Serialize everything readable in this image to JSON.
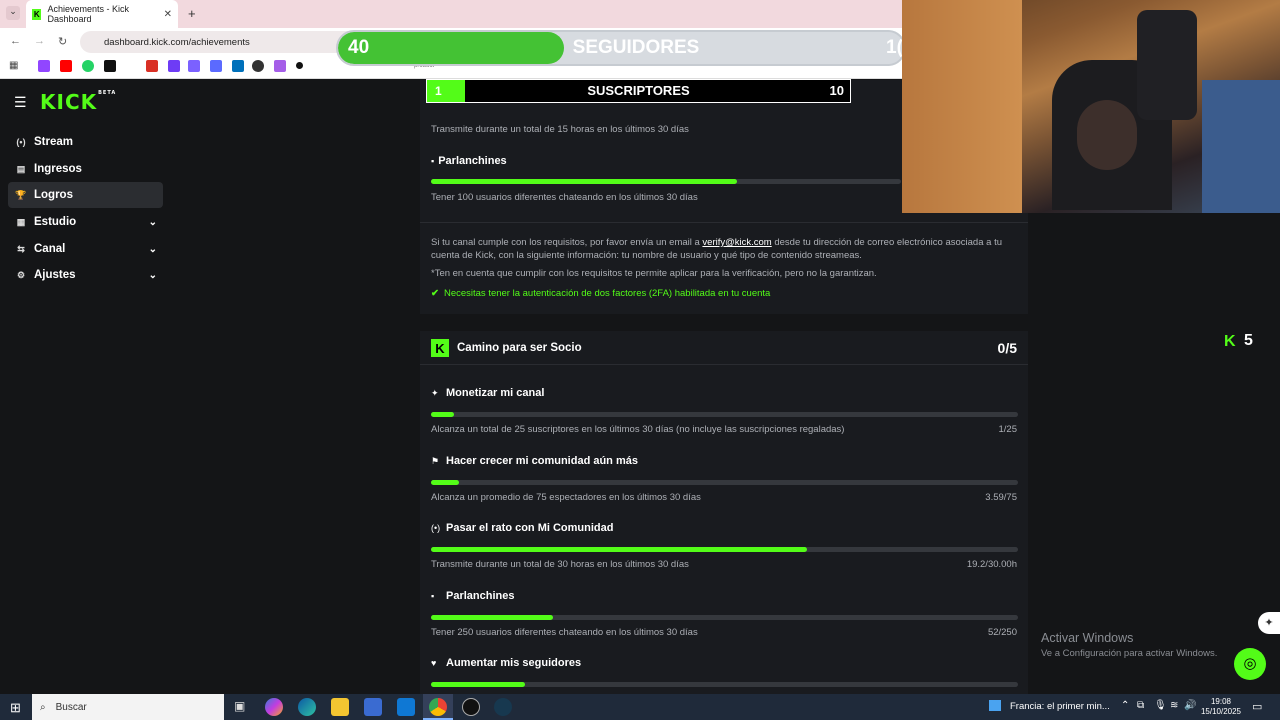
{
  "browser": {
    "tab_title": "Achievements - Kick Dashboard",
    "tab_favicon": "K",
    "tab_close": "✕",
    "new_tab": "+",
    "url": "dashboard.kick.com/achievements",
    "bookmark_fragment": "product"
  },
  "sidebar": {
    "logo": "KICK",
    "logo_badge": "BETA",
    "items": [
      {
        "label": "Stream",
        "icon": "(•)"
      },
      {
        "label": "Ingresos",
        "icon": "▤"
      },
      {
        "label": "Logros",
        "icon": "🏆"
      },
      {
        "label": "Estudio",
        "icon": "▦"
      },
      {
        "label": "Canal",
        "icon": "⇆"
      },
      {
        "label": "Ajustes",
        "icon": "⚙"
      }
    ]
  },
  "overlay_followers": {
    "current": "40",
    "label": "SEGUIDORES",
    "target": "1("
  },
  "overlay_subs": {
    "current": "1",
    "label": "SUSCRIPTORES",
    "target": "10"
  },
  "verification": {
    "hours_text": "Transmite durante un total de 15 horas en los últimos 30 días",
    "chatters_title": "Parlanchines",
    "chatters_text": "Tener 100 usuarios diferentes chateando en los últimos 30 días",
    "chatters_progress": 0.65,
    "info_line1": "Si tu canal cumple con los requisitos, por favor envía un email a",
    "info_email": "verify@kick.com",
    "info_line1b": "desde tu dirección de correo electrónico asociada",
    "info_line2": "a tu cuenta de Kick, con la siguiente información: tu nombre de usuario y qué tipo de contenido streameas.",
    "info_note": "*Ten en cuenta que cumplir con los requisitos te permite aplicar para la verificación, pero no la garantizan.",
    "twofa": "Necesitas tener la autenticación de dos factores (2FA) habilitada en tu cuenta"
  },
  "partner": {
    "title": "Camino para ser Socio",
    "count": "0/5",
    "items": [
      {
        "icon": "✦",
        "title": "Monetizar mi canal",
        "desc": "Alcanza un total de 25 suscriptores en los últimos 30 días (no incluye las suscripciones regaladas)",
        "value": "1/25",
        "progress": 0.04
      },
      {
        "icon": "⚑",
        "title": "Hacer crecer mi comunidad aún más",
        "desc": "Alcanza un promedio de 75 espectadores en los últimos 30 días",
        "value": "3.59/75",
        "progress": 0.048
      },
      {
        "icon": "(•)",
        "title": "Pasar el rato con Mi Comunidad",
        "desc": "Transmite durante un total de 30 horas en los últimos 30 días",
        "value": "19.2/30.00h",
        "progress": 0.64
      },
      {
        "icon": "▪",
        "title": "Parlanchines",
        "desc": "Tener 250 usuarios diferentes chateando en los últimos 30 días",
        "value": "52/250",
        "progress": 0.208
      },
      {
        "icon": "♥",
        "title": "Aumentar mis seguidores",
        "desc": "",
        "value": "",
        "progress": 0.16
      }
    ]
  },
  "side_badge": "5",
  "windows_watermark": {
    "title": "Activar Windows",
    "subtitle": "Ve a Configuración para activar Windows."
  },
  "taskbar": {
    "search": "Buscar",
    "news": "Francia: el primer min...",
    "time": "19:08",
    "date": "15/10/2025"
  },
  "colors": {
    "accent": "#53fc18",
    "bg": "#141517",
    "card": "#191b1f",
    "track": "#35383d"
  }
}
